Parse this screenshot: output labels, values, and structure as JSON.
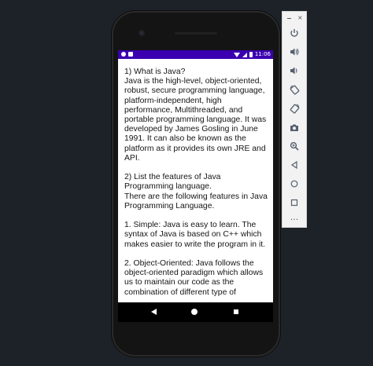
{
  "status_bar": {
    "time": "11:06"
  },
  "article": {
    "text": "1) What is Java?\nJava is the high-level, object-oriented, robust, secure programming language, platform-independent, high performance, Multithreaded, and portable programming language. It was developed by James Gosling in June 1991. It can also be known as the platform as it provides its own JRE and API.\n\n2) List the features of Java Programming language.\nThere are the following features in Java Programming Language.\n\n1. Simple: Java is easy to learn. The syntax of Java is based on C++ which makes easier to write the program in it.\n\n2. Object-Oriented: Java follows the object-oriented paradigm which allows us to maintain our code as the combination of different type of"
  },
  "colors": {
    "status_bar": "#3b00b0",
    "content_background": "#ffffff",
    "desktop_background": "#1d2228",
    "toolbar_background": "#f2f2f2"
  },
  "icons": {
    "status_left": [
      "settings-icon",
      "notification-icon"
    ],
    "status_right": [
      "wifi-icon",
      "signal-icon",
      "battery-icon"
    ],
    "navigation": [
      "back-icon",
      "home-icon",
      "recents-icon"
    ],
    "toolbar": [
      "power-icon",
      "volume-up-icon",
      "volume-down-icon",
      "rotate-left-icon",
      "rotate-right-icon",
      "camera-icon",
      "zoom-icon",
      "back-icon",
      "home-icon",
      "overview-icon",
      "more-icon"
    ]
  },
  "toolbar": {
    "close_label": "×",
    "more_label": "···"
  }
}
